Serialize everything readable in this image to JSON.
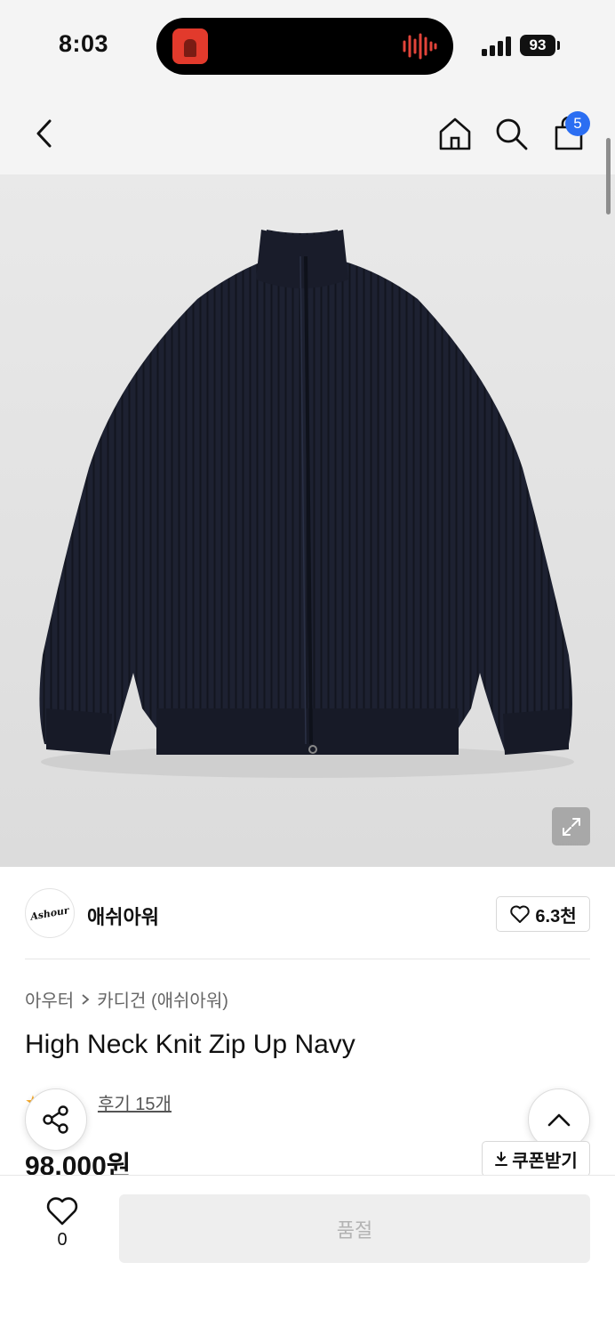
{
  "status_bar": {
    "time": "8:03",
    "battery": "93"
  },
  "nav": {
    "cart_count": "5",
    "icons": [
      "back-icon",
      "home-icon",
      "search-icon",
      "shopping-bag-icon"
    ]
  },
  "product": {
    "image_subject": "navy high neck knit zip-up cardigan",
    "brand_name": "애쉬아워",
    "brand_logo_text": "Ashour",
    "like_count": "6.3천",
    "breadcrumb": [
      "아우터",
      "카디건 (애쉬아워)"
    ],
    "title": "High Neck Knit Zip Up Navy",
    "review_text": "후기 15개",
    "price": "98,000원",
    "coupon_label": "쿠폰받기"
  },
  "bottom_bar": {
    "wish_count": "0",
    "soldout_label": "품절"
  },
  "colors": {
    "accent": "#2b6ef2",
    "garment": "#1c2030",
    "background": "#f4f4f4"
  }
}
